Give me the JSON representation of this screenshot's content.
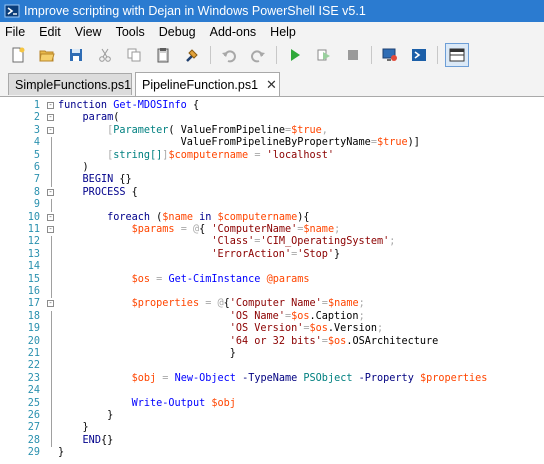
{
  "window": {
    "title": "Improve scripting with Dejan in Windows PowerShell ISE v5.1"
  },
  "menu": [
    "File",
    "Edit",
    "View",
    "Tools",
    "Debug",
    "Add-ons",
    "Help"
  ],
  "toolbar": {
    "buttons": [
      "new-file-icon",
      "open-folder-icon",
      "save-icon",
      "cut-icon",
      "copy-icon",
      "paste-icon",
      "clear-console-icon",
      "undo-icon",
      "redo-icon",
      "run-script-icon",
      "run-selection-icon",
      "stop-icon",
      "new-remote-tab-icon",
      "start-powershell-icon",
      "show-script-pane-icon"
    ]
  },
  "tabs": [
    {
      "label": "SimpleFunctions.ps1",
      "active": false
    },
    {
      "label": "PipelineFunction.ps1",
      "active": true,
      "close": "✕"
    }
  ],
  "code": {
    "lines": [
      "function Get-MDOSInfo {",
      "    param(",
      "        [Parameter( ValueFromPipeline=$true,",
      "                    ValueFromPipelineByPropertyName=$true)]",
      "        [string[]]$computername = 'localhost'",
      "    )",
      "    BEGIN {}",
      "    PROCESS {",
      "",
      "        foreach ($name in $computername){",
      "            $params = @{ 'ComputerName'=$name;",
      "                         'Class'='CIM_OperatingSystem';",
      "                         'ErrorAction'='Stop'}",
      "",
      "            $os = Get-CimInstance @params",
      "",
      "            $properties = @{'Computer Name'=$name;",
      "                            'OS Name'=$os.Caption;",
      "                            'OS Version'=$os.Version;",
      "                            '64 or 32 bits'=$os.OSArchitecture",
      "                            }",
      "",
      "            $obj = New-Object -TypeName PSObject -Property $properties",
      "",
      "            Write-Output $obj",
      "        }",
      "    }",
      "    END{}",
      "}"
    ],
    "folds": [
      1,
      2,
      3,
      8,
      10,
      11,
      17
    ]
  },
  "colors": {
    "titlebar": "#2b7bd0",
    "keyword": "#00008b",
    "command": "#0000ff",
    "variable": "#ff4500",
    "string": "#8b0000",
    "type": "#008080",
    "line_number": "#2b91af"
  }
}
